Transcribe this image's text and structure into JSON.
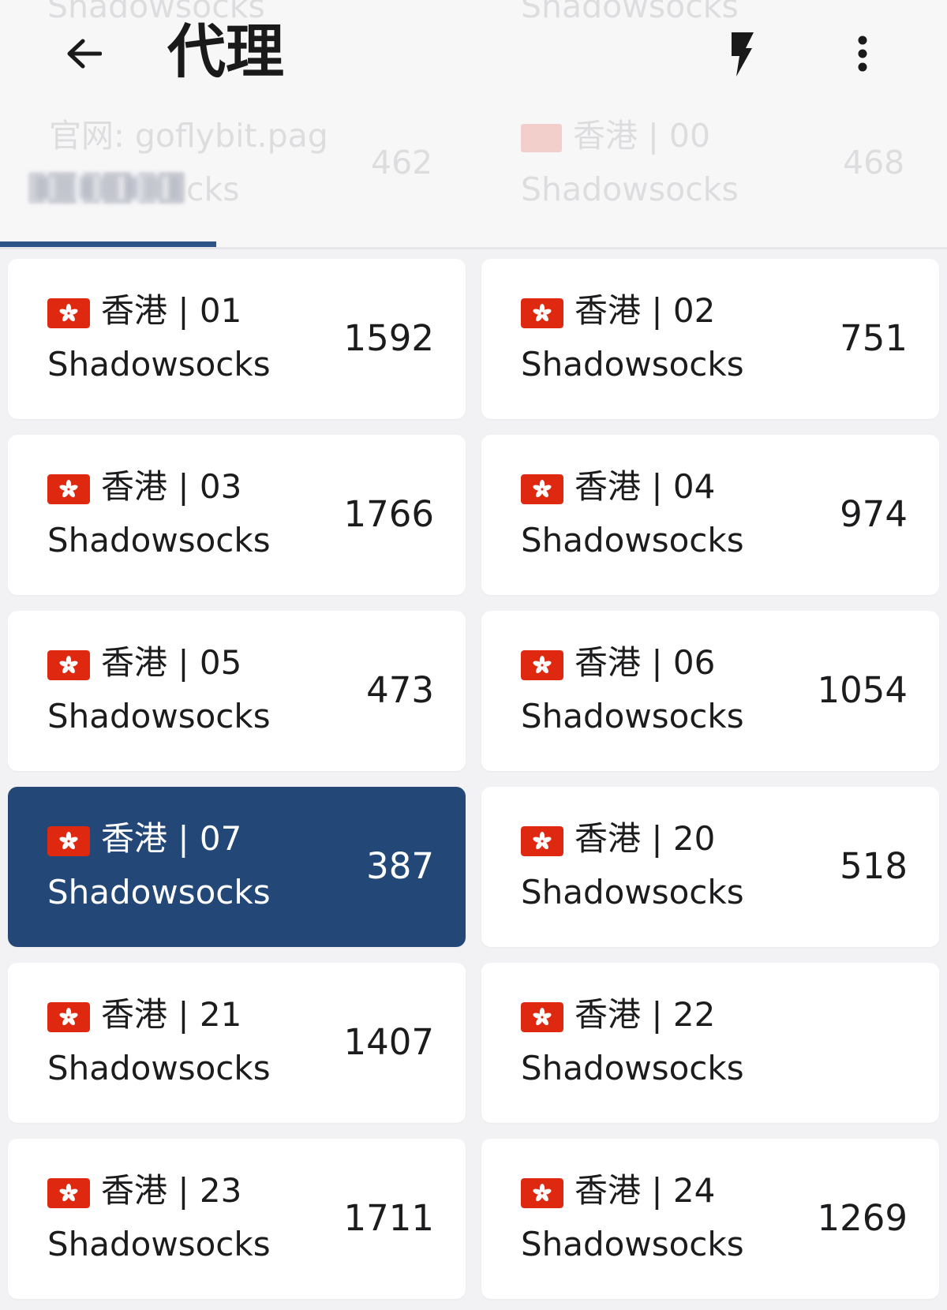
{
  "header": {
    "title": "代理",
    "tab_label": "",
    "ghost_texts": [
      "Shadowsocks",
      "Shadowsocks",
      "官网: goflybit.pag",
      "cks",
      "462",
      "香港 | 00",
      "Shadowsocks",
      "468"
    ]
  },
  "icons": {
    "back": "arrow-left",
    "action": "lightning-bolt",
    "menu": "vertical-dots"
  },
  "colors": {
    "accent": "#234878",
    "tab_indicator": "#2c5486",
    "card_bg": "#ffffff",
    "page_bg": "#f2f2f4",
    "flag_red": "#de2910"
  },
  "proxies": [
    {
      "name": "香港 | 01",
      "protocol": "Shadowsocks",
      "latency": "1592",
      "selected": false
    },
    {
      "name": "香港 | 02",
      "protocol": "Shadowsocks",
      "latency": "751",
      "selected": false
    },
    {
      "name": "香港 | 03",
      "protocol": "Shadowsocks",
      "latency": "1766",
      "selected": false
    },
    {
      "name": "香港 | 04",
      "protocol": "Shadowsocks",
      "latency": "974",
      "selected": false
    },
    {
      "name": "香港 | 05",
      "protocol": "Shadowsocks",
      "latency": "473",
      "selected": false
    },
    {
      "name": "香港 | 06",
      "protocol": "Shadowsocks",
      "latency": "1054",
      "selected": false
    },
    {
      "name": "香港 | 07",
      "protocol": "Shadowsocks",
      "latency": "387",
      "selected": true
    },
    {
      "name": "香港 | 20",
      "protocol": "Shadowsocks",
      "latency": "518",
      "selected": false
    },
    {
      "name": "香港 | 21",
      "protocol": "Shadowsocks",
      "latency": "1407",
      "selected": false
    },
    {
      "name": "香港 | 22",
      "protocol": "Shadowsocks",
      "latency": "",
      "selected": false
    },
    {
      "name": "香港 | 23",
      "protocol": "Shadowsocks",
      "latency": "1711",
      "selected": false
    },
    {
      "name": "香港 | 24",
      "protocol": "Shadowsocks",
      "latency": "1269",
      "selected": false
    }
  ]
}
